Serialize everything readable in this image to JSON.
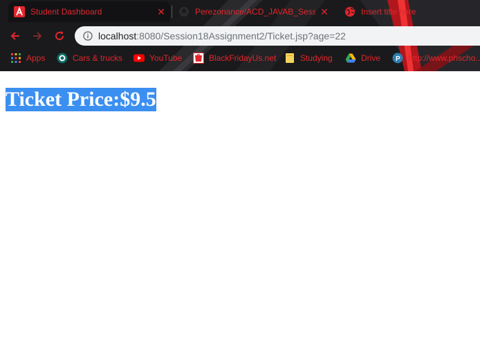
{
  "tabs": [
    {
      "title": "Student Dashboard",
      "active": true,
      "favicon": "app-a-icon"
    },
    {
      "title": "Perezonance/ACD_JAVAB_Session",
      "active": false,
      "favicon": "github-icon"
    },
    {
      "title": "Insert title here",
      "active": false,
      "favicon": "globe-icon"
    }
  ],
  "address_bar": {
    "host": "localhost",
    "rest": ":8080/Session18Assignment2/Ticket.jsp?age=22"
  },
  "bookmarks": [
    {
      "label": "Apps",
      "icon": "apps-grid-icon"
    },
    {
      "label": "Cars & trucks",
      "icon": "cars-icon"
    },
    {
      "label": "YouTube",
      "icon": "youtube-icon"
    },
    {
      "label": "BlackFridayUs.net",
      "icon": "blackfriday-icon"
    },
    {
      "label": "Studying",
      "icon": "folder-icon"
    },
    {
      "label": "Drive",
      "icon": "drive-icon"
    },
    {
      "label": "http://www.phscho...",
      "icon": "pearson-icon"
    }
  ],
  "content": {
    "heading": "Ticket Price:$9.5"
  },
  "colors": {
    "accent": "#e3262c",
    "selection": "#3b8ff0",
    "chrome": "#1b1b1d"
  }
}
